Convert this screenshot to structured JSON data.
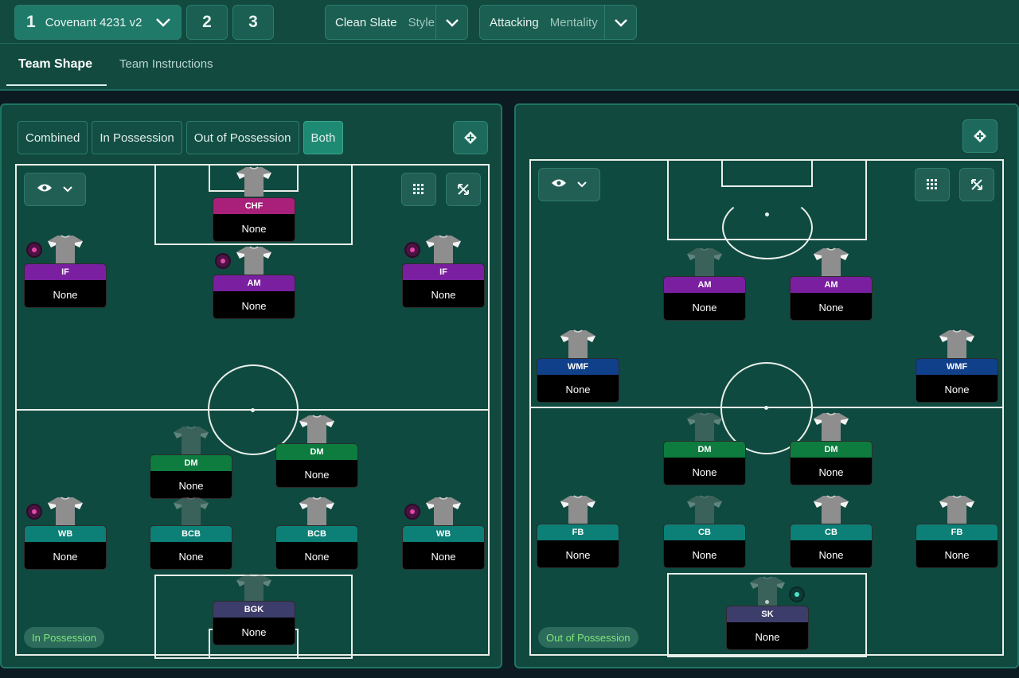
{
  "header": {
    "tactic_number": "1",
    "tactic_name": "Covenant 4231 v2",
    "slot_2": "2",
    "slot_3": "3",
    "style_value": "Clean Slate",
    "style_label": "Style",
    "mentality_value": "Attacking",
    "mentality_label": "Mentality"
  },
  "tabs": {
    "team_shape": "Team Shape",
    "team_instructions": "Team Instructions"
  },
  "view_modes": [
    "Combined",
    "In Possession",
    "Out of Possession",
    "Both"
  ],
  "active_view_mode": "Both",
  "left_panel": {
    "mode_label": "In Possession",
    "players": [
      {
        "role": "CHF",
        "name": "None",
        "color": "#a8207a"
      },
      {
        "role": "IF",
        "name": "None",
        "color": "#7a1fa0"
      },
      {
        "role": "AM",
        "name": "None",
        "color": "#7a1fa0"
      },
      {
        "role": "IF",
        "name": "None",
        "color": "#7a1fa0"
      },
      {
        "role": "DM",
        "name": "None",
        "color": "#0d7c3e"
      },
      {
        "role": "DM",
        "name": "None",
        "color": "#0d7c3e"
      },
      {
        "role": "WB",
        "name": "None",
        "color": "#0c8076"
      },
      {
        "role": "BCB",
        "name": "None",
        "color": "#0c8076"
      },
      {
        "role": "BCB",
        "name": "None",
        "color": "#0c8076"
      },
      {
        "role": "WB",
        "name": "None",
        "color": "#0c8076"
      },
      {
        "role": "BGK",
        "name": "None",
        "color": "#3d3d6b"
      }
    ]
  },
  "right_panel": {
    "mode_label": "Out of Possession",
    "players": [
      {
        "role": "AM",
        "name": "None",
        "color": "#7a1fa0"
      },
      {
        "role": "AM",
        "name": "None",
        "color": "#7a1fa0"
      },
      {
        "role": "WMF",
        "name": "None",
        "color": "#10408a"
      },
      {
        "role": "WMF",
        "name": "None",
        "color": "#10408a"
      },
      {
        "role": "DM",
        "name": "None",
        "color": "#0d7c3e"
      },
      {
        "role": "DM",
        "name": "None",
        "color": "#0d7c3e"
      },
      {
        "role": "FB",
        "name": "None",
        "color": "#0c8076"
      },
      {
        "role": "CB",
        "name": "None",
        "color": "#0c8076"
      },
      {
        "role": "CB",
        "name": "None",
        "color": "#0c8076"
      },
      {
        "role": "FB",
        "name": "None",
        "color": "#0c8076"
      },
      {
        "role": "SK",
        "name": "None",
        "color": "#3d3d6b"
      }
    ]
  },
  "icons": {
    "dropdown": "chevron-down-icon",
    "visibility": "eye-icon",
    "grid": "grid-icon",
    "expand": "expand-icon",
    "swap": "swap-icon",
    "player_shirt": "shirt-icon",
    "player_status": "status-dot-icon"
  }
}
